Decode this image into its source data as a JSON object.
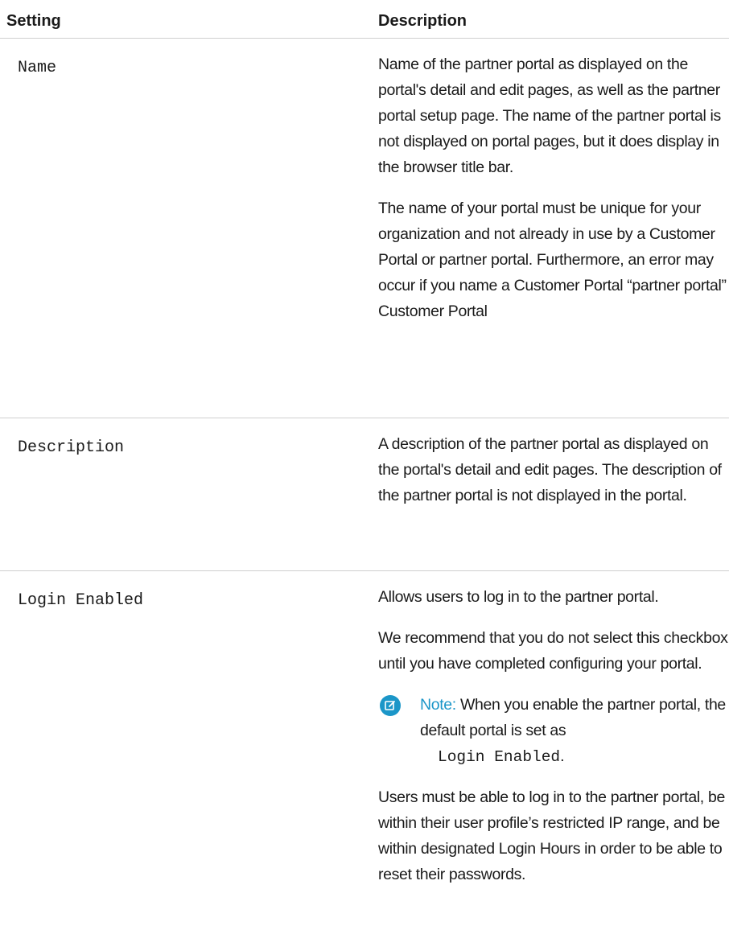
{
  "table": {
    "headers": {
      "setting": "Setting",
      "description": "Description"
    },
    "rows": [
      {
        "setting": "Name",
        "paragraphs": [
          "Name of the partner portal as displayed on the portal's detail and edit pages, as well as the partner portal setup page. The name of the partner portal is not displayed on portal pages, but it does display in the browser title bar.",
          "The name of your portal must be unique for your organization and not already in use by a Customer Portal or partner portal. Furthermore, an error may occur if you name a Customer Portal “partner portal” Customer Portal"
        ]
      },
      {
        "setting": "Description",
        "paragraphs": [
          "A description of the partner portal as displayed on the portal's detail and edit pages. The description of the partner portal is not displayed in the portal."
        ]
      },
      {
        "setting": "Login Enabled",
        "paragraphs": [
          "Allows users to log in to the partner portal.",
          "We recommend that you do not select this checkbox until you have completed configuring your portal."
        ],
        "note": {
          "label": "Note:",
          "text": "When you enable the partner portal, the default portal is set as",
          "code": "Login Enabled",
          "suffix": "."
        },
        "after_note": "Users must be able to log in to the partner portal, be within their user profile’s restricted IP range, and be within designated Login Hours in order to be able to reset their passwords."
      }
    ]
  },
  "icons": {
    "note": "edit-note-icon"
  },
  "colors": {
    "accent": "#1b96c8",
    "divider": "#cfcfcf",
    "text": "#1a1a1a"
  }
}
